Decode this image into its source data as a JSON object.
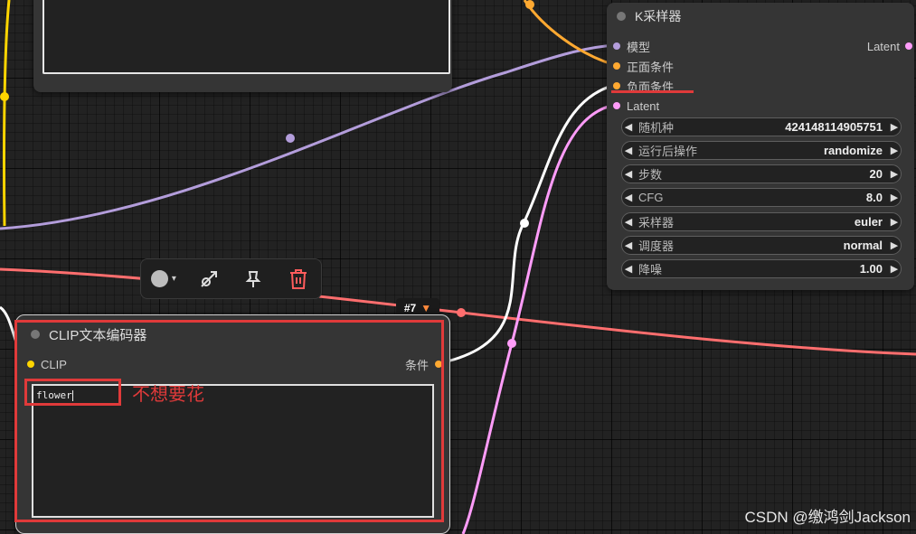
{
  "ksampler": {
    "title": "K采样器",
    "inputs": [
      {
        "label": "模型",
        "color": "#b39ddb"
      },
      {
        "label": "正面条件",
        "color": "#ffa931"
      },
      {
        "label": "负面条件",
        "color": "#ffa931"
      },
      {
        "label": "Latent",
        "color": "#ff9cf9"
      }
    ],
    "output": {
      "label": "Latent",
      "color": "#ff9cf9"
    },
    "widgets": [
      {
        "label": "随机种",
        "value": "424148114905751"
      },
      {
        "label": "运行后操作",
        "value": "randomize"
      },
      {
        "label": "步数",
        "value": "20"
      },
      {
        "label": "CFG",
        "value": "8.0"
      },
      {
        "label": "采样器",
        "value": "euler"
      },
      {
        "label": "调度器",
        "value": "normal"
      },
      {
        "label": "降噪",
        "value": "1.00"
      }
    ]
  },
  "clip_node": {
    "title": "CLIP文本编码器",
    "input_label": "CLIP",
    "output_label": "条件",
    "text_value": "flower",
    "badge": "#7"
  },
  "annotation": {
    "text": "不想要花"
  },
  "toolbar": {
    "color_icon": "circle-color-icon",
    "bypass_icon": "bypass-icon",
    "pin_icon": "pin-icon",
    "delete_icon": "trash-icon"
  },
  "watermark": "CSDN @缴鸿剑Jackson",
  "colors": {
    "model": "#b39ddb",
    "conditioning": "#ffa931",
    "latent": "#ff9cf9",
    "clip": "#ffd500",
    "vae": "#ff6e6e",
    "highlight": "#e03a3a"
  }
}
